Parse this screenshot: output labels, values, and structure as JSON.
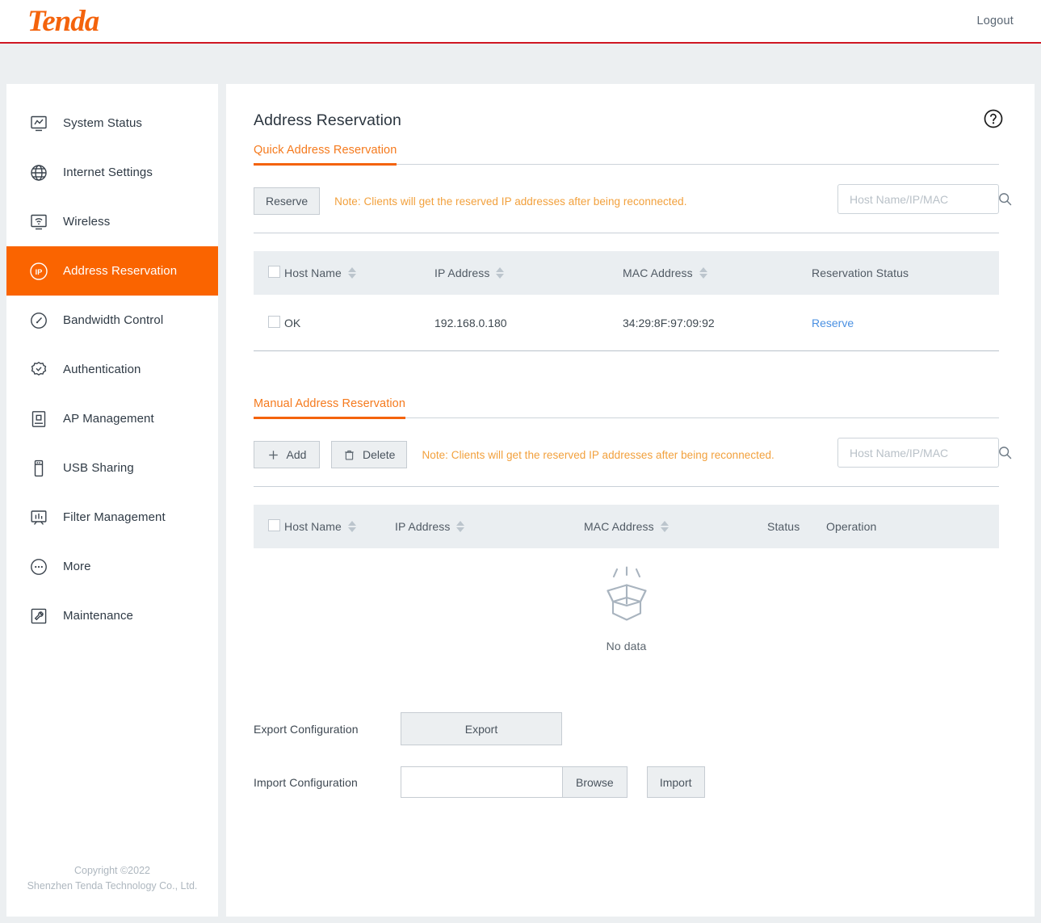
{
  "header": {
    "brand": "Tenda",
    "logout_label": "Logout"
  },
  "sidebar": {
    "items": [
      {
        "label": "System Status",
        "icon": "monitor-chart-icon",
        "active": false
      },
      {
        "label": "Internet Settings",
        "icon": "globe-icon",
        "active": false
      },
      {
        "label": "Wireless",
        "icon": "wifi-monitor-icon",
        "active": false
      },
      {
        "label": "Address Reservation",
        "icon": "ip-circle-icon",
        "active": true
      },
      {
        "label": "Bandwidth Control",
        "icon": "gauge-icon",
        "active": false
      },
      {
        "label": "Authentication",
        "icon": "verified-badge-icon",
        "active": false
      },
      {
        "label": "AP Management",
        "icon": "ap-device-icon",
        "active": false
      },
      {
        "label": "USB Sharing",
        "icon": "usb-drive-icon",
        "active": false
      },
      {
        "label": "Filter Management",
        "icon": "filter-bars-icon",
        "active": false
      },
      {
        "label": "More",
        "icon": "ellipsis-circle-icon",
        "active": false
      },
      {
        "label": "Maintenance",
        "icon": "wrench-icon",
        "active": false
      }
    ],
    "copyright_line1": "Copyright ©2022",
    "copyright_line2": "Shenzhen Tenda Technology Co., Ltd."
  },
  "main": {
    "page_title": "Address Reservation",
    "help_icon": "question-circle-icon",
    "quick": {
      "tab_label": "Quick Address Reservation",
      "reserve_button": "Reserve",
      "note": "Note: Clients will get the reserved IP addresses after being reconnected.",
      "search_placeholder": "Host Name/IP/MAC",
      "search_value": "",
      "search_icon": "search-icon",
      "columns": [
        "Host Name",
        "IP Address",
        "MAC Address",
        "Reservation Status"
      ],
      "rows": [
        {
          "checked": false,
          "host_name": "OK",
          "ip_address": "192.168.0.180",
          "mac_address": "34:29:8F:97:09:92",
          "status_action": "Reserve"
        }
      ]
    },
    "manual": {
      "tab_label": "Manual Address Reservation",
      "add_button": "Add",
      "add_icon": "plus-icon",
      "delete_button": "Delete",
      "delete_icon": "trash-icon",
      "note": "Note: Clients will get the reserved IP addresses after being reconnected.",
      "search_placeholder": "Host Name/IP/MAC",
      "search_value": "",
      "search_icon": "search-icon",
      "columns": [
        "Host Name",
        "IP Address",
        "MAC Address",
        "Status",
        "Operation"
      ],
      "rows": [],
      "empty_icon": "open-box-icon",
      "empty_text": "No data"
    },
    "config": {
      "export_label": "Export Configuration",
      "export_button": "Export",
      "import_label": "Import Configuration",
      "import_path_value": "",
      "browse_button": "Browse",
      "import_button": "Import"
    }
  },
  "colors": {
    "brand_orange": "#f4630c",
    "active_orange": "#fa6400",
    "header_rule_red": "#cf1723",
    "note_orange": "#f2a03c",
    "link_blue": "#4a90e2",
    "page_bg": "#eceff1",
    "table_head_bg": "#eaeef1",
    "empty_gray": "#a9b4bf"
  }
}
